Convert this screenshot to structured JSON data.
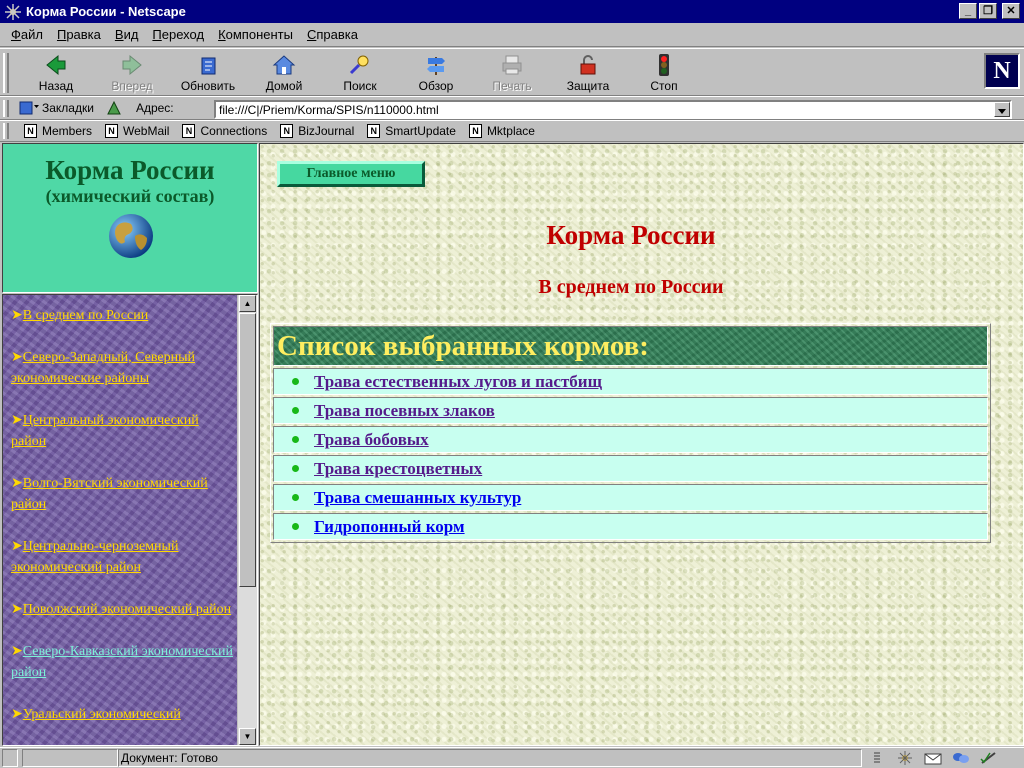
{
  "window": {
    "title": "Корма России - Netscape"
  },
  "menu": {
    "items": [
      {
        "u": "Ф",
        "rest": "айл"
      },
      {
        "u": "П",
        "rest": "равка"
      },
      {
        "u": "В",
        "rest": "ид"
      },
      {
        "u": "П",
        "rest": "ереход"
      },
      {
        "u": "К",
        "rest": "омпоненты"
      },
      {
        "u": "С",
        "rest": "правка"
      }
    ]
  },
  "toolbar": {
    "back": "Назад",
    "forward": "Вперед",
    "reload": "Обновить",
    "home": "Домой",
    "search": "Поиск",
    "guide": "Обзор",
    "print": "Печать",
    "security": "Защита",
    "stop": "Стоп",
    "logo": "N"
  },
  "location": {
    "bookmarks_label": "Закладки",
    "address_label": "Адрес:",
    "url": "file:///C|/Priem/Korma/SPIS/n110000.html"
  },
  "personal_toolbar": {
    "items": [
      "Members",
      "WebMail",
      "Connections",
      "BizJournal",
      "SmartUpdate",
      "Mktplace"
    ]
  },
  "left_frame": {
    "title": "Корма России",
    "subtitle": "(химический состав)",
    "nav": [
      {
        "arrow": "➤",
        "label": "В среднем по России",
        "visited": false
      },
      {
        "arrow": "➤",
        "label": "Северо-Западный, Северный экономические районы",
        "visited": false
      },
      {
        "arrow": "➤",
        "label": "Центральный экономический район",
        "visited": false
      },
      {
        "arrow": "➤",
        "label": "Волго-Вятский экономический район",
        "visited": false
      },
      {
        "arrow": "➤",
        "label": "Центрально-черноземный экономический район",
        "visited": false
      },
      {
        "arrow": "➤",
        "label": "Поволжский экономический район",
        "visited": false
      },
      {
        "arrow": "➤",
        "label": "Северо-Кавказский экономический район",
        "visited": true
      },
      {
        "arrow": "➤",
        "label": "Уральский экономический",
        "visited": false
      }
    ]
  },
  "main": {
    "menu_button": "Главное меню",
    "title": "Корма России",
    "subtitle": "В среднем по России",
    "list_header": "Список выбранных кормов:",
    "items": [
      {
        "label": "Трава естественных лугов и пастбищ",
        "visited": true
      },
      {
        "label": "Трава посевных злаков",
        "visited": true
      },
      {
        "label": "Трава бобовых",
        "visited": true
      },
      {
        "label": "Трава крестоцветных",
        "visited": true
      },
      {
        "label": "Трава смешанных культур",
        "visited": false
      },
      {
        "label": "Гидропонный корм",
        "visited": false
      }
    ]
  },
  "status": {
    "text": "Документ: Готово"
  },
  "colors": {
    "titlebar": "#000080",
    "left_header_bg": "#4fd8a6",
    "nav_link": "#ffd800",
    "nav_visited": "#7cf0d8",
    "heading_red": "#c00000",
    "row_bg": "#c8fff0"
  }
}
